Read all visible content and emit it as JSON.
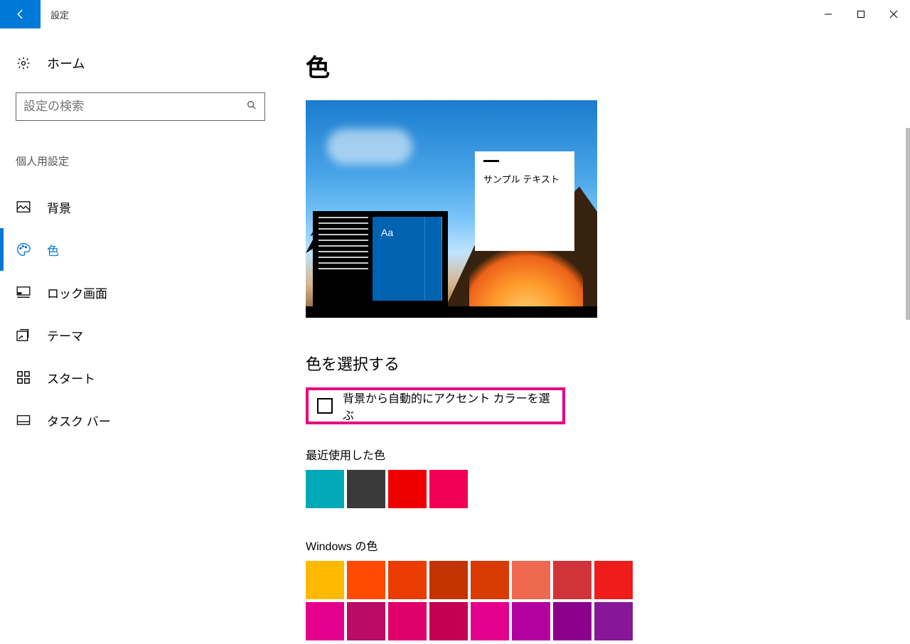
{
  "titlebar": {
    "title": "設定"
  },
  "sidebar": {
    "home": "ホーム",
    "search_placeholder": "設定の検索",
    "section": "個人用設定",
    "items": [
      {
        "label": "背景"
      },
      {
        "label": "色"
      },
      {
        "label": "ロック画面"
      },
      {
        "label": "テーマ"
      },
      {
        "label": "スタート"
      },
      {
        "label": "タスク バー"
      }
    ]
  },
  "main": {
    "page_title": "色",
    "preview": {
      "sample_text": "サンプル テキスト",
      "tile_text": "Aa"
    },
    "pick_color_heading": "色を選択する",
    "auto_accent_label": "背景から自動的にアクセント カラーを選ぶ",
    "recent_heading": "最近使用した色",
    "recent_colors": [
      "#00a9b5",
      "#3a3a3a",
      "#ef0000",
      "#ef0053"
    ],
    "windows_colors_heading": "Windows の色",
    "windows_colors": [
      "#ffb900",
      "#ff4a00",
      "#ea3c00",
      "#c43300",
      "#d83b01",
      "#ef6950",
      "#d03438",
      "#ef1c1c",
      "#e3008c",
      "#b80c66",
      "#e0006b",
      "#c30052",
      "#e3008c",
      "#b4009e",
      "#8b008b",
      "#881798"
    ]
  }
}
